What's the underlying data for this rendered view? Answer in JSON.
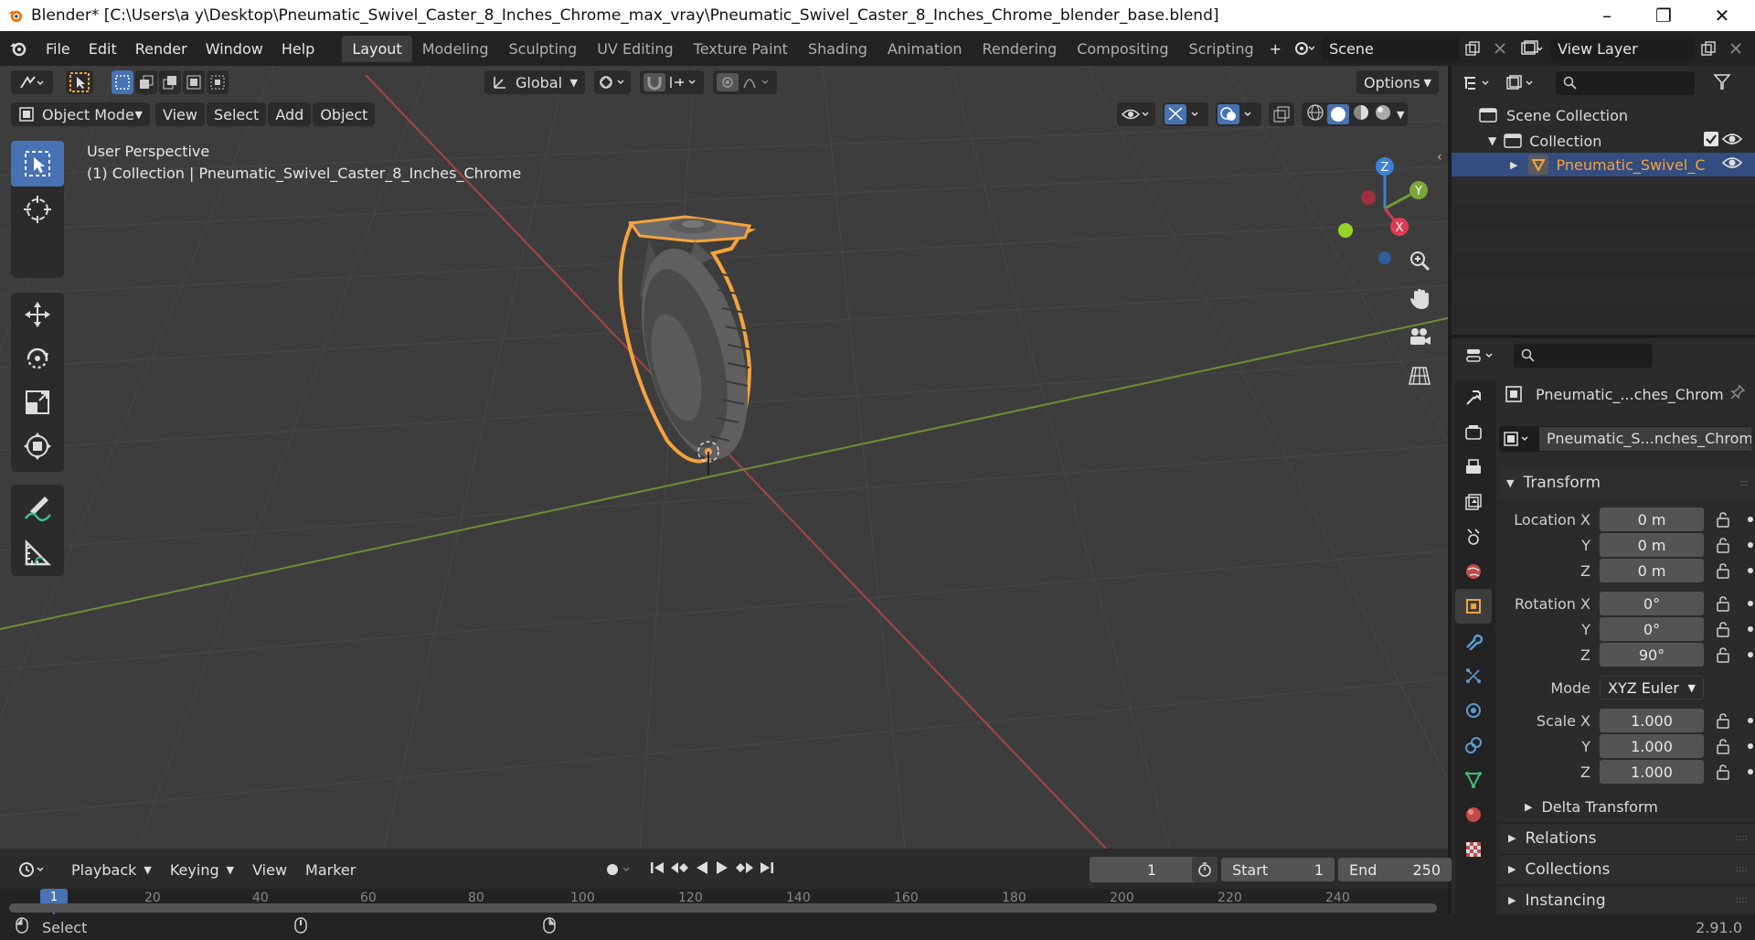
{
  "window": {
    "title": "Blender* [C:\\Users\\a y\\Desktop\\Pneumatic_Swivel_Caster_8_Inches_Chrome_max_vray\\Pneumatic_Swivel_Caster_8_Inches_Chrome_blender_base.blend]",
    "minimize": "–",
    "maximize": "❐",
    "close": "✕"
  },
  "menu": [
    "File",
    "Edit",
    "Render",
    "Window",
    "Help"
  ],
  "workspaces": [
    "Layout",
    "Modeling",
    "Sculpting",
    "UV Editing",
    "Texture Paint",
    "Shading",
    "Animation",
    "Rendering",
    "Compositing",
    "Scripting"
  ],
  "active_workspace": "Layout",
  "scene": {
    "label": "Scene",
    "view_layer": "View Layer",
    "add_tab": "+"
  },
  "viewport": {
    "mode": "Object Mode",
    "header_menus": [
      "View",
      "Select",
      "Add",
      "Object"
    ],
    "transform_orientation": "Global",
    "options": "Options",
    "overlay_title": "User Perspective",
    "overlay_sub": "(1) Collection | Pneumatic_Swivel_Caster_8_Inches_Chrome",
    "gizmo": {
      "z": "Z",
      "y": "Y",
      "x": "X"
    }
  },
  "outliner": {
    "scene_collection": "Scene Collection",
    "collection": "Collection",
    "object": "Pneumatic_Swivel_C"
  },
  "properties": {
    "object_name": "Pneumatic_...ches_Chrom",
    "mesh_name": "Pneumatic_S...nches_Chrome",
    "transform_header": "Transform",
    "location": {
      "label": "Location X",
      "x": "0 m",
      "y": "0 m",
      "z": "0 m"
    },
    "rotation": {
      "label": "Rotation X",
      "x": "0°",
      "y": "0°",
      "z": "90°"
    },
    "mode": {
      "label": "Mode",
      "value": "XYZ Euler"
    },
    "scale": {
      "label": "Scale X",
      "x": "1.000",
      "y": "1.000",
      "z": "1.000"
    },
    "axis_y": "Y",
    "axis_z": "Z",
    "panels": [
      "Delta Transform",
      "Relations",
      "Collections",
      "Instancing"
    ]
  },
  "timeline": {
    "menus": [
      "Playback",
      "Keying",
      "View",
      "Marker"
    ],
    "current_frame": "1",
    "start_label": "Start",
    "start": "1",
    "end_label": "End",
    "end": "250",
    "ruler": [
      "1",
      "20",
      "40",
      "60",
      "80",
      "100",
      "120",
      "140",
      "160",
      "180",
      "200",
      "220",
      "240"
    ]
  },
  "status": {
    "select": "Select",
    "version": "2.91.0"
  },
  "colors": {
    "accent": "#4772b3",
    "selection": "#f5a33d",
    "x_axis": "#c04a4a",
    "y_axis": "#6f9a32"
  }
}
